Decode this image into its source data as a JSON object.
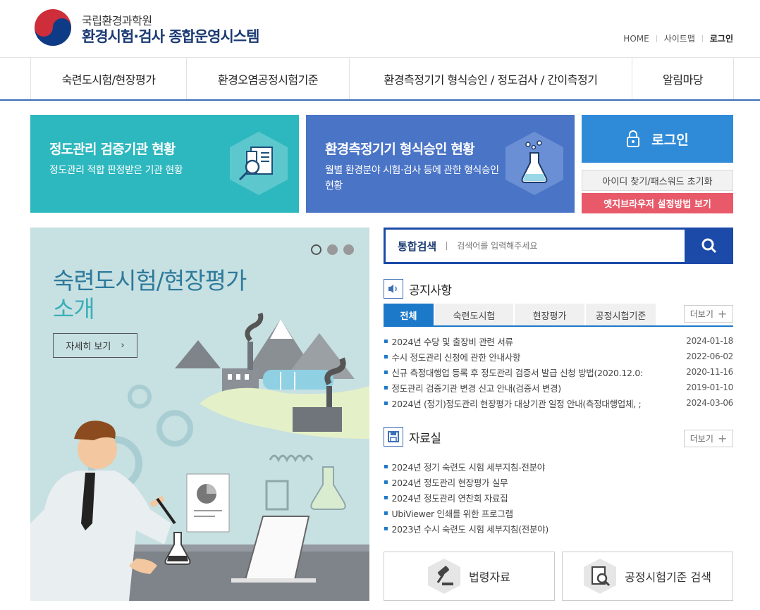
{
  "header": {
    "org_name": "국립환경과학원",
    "system_name": "환경시험·검사 종합운영시스템",
    "util": [
      "HOME",
      "사이트맵",
      "로그인"
    ]
  },
  "gnb": [
    "숙련도시험/현장평가",
    "환경오염공정시험기준",
    "환경측정기기 형식승인 / 정도검사 / 간이측정기",
    "알림마당"
  ],
  "banners": [
    {
      "title": "정도관리 검증기관 현황",
      "desc": "정도관리 적합 판정받은 기관 현황",
      "icon": "document-search-icon"
    },
    {
      "title": "환경측정기기 형식승인 현황",
      "desc": "월별 환경분야 시험·검사 등에 관한 형식승인 현황",
      "icon": "flask-icon"
    }
  ],
  "login": {
    "label": "로그인",
    "find": "아이디 찾기/패스워드 초기화",
    "edge": "엣지브라우저 설정방법 보기"
  },
  "visual": {
    "title": "숙련도시험/현장평가",
    "subtitle": "소개",
    "more": "자세히 보기"
  },
  "search": {
    "label": "통합검색",
    "placeholder": "검색어를 입력해주세요"
  },
  "notice": {
    "title": "공지사항",
    "tabs": [
      "전체",
      "숙련도시험",
      "현장평가",
      "공정시험기준"
    ],
    "more": "더보기",
    "items": [
      {
        "title": "2024년 수당 및 출장비 관련 서류",
        "date": "2024-01-18"
      },
      {
        "title": "수시 정도관리 신청에 관한 안내사항",
        "date": "2022-06-02"
      },
      {
        "title": "신규 측정대행업 등록 후 정도관리 검증서 발급 신청 방법(2020.12.0:",
        "date": "2020-11-16"
      },
      {
        "title": "정도관리 검증기관 변경 신고 안내(검증서 변경)",
        "date": "2019-01-10"
      },
      {
        "title": "2024년 (정기)정도관리 현장평가 대상기관 일정 안내(측정대행업체, ;",
        "date": "2024-03-06"
      }
    ]
  },
  "library": {
    "title": "자료실",
    "more": "더보기",
    "items": [
      {
        "title": "2024년 정기 숙련도 시험 세부지침-전분야"
      },
      {
        "title": "2024년 정도관리 현장평가 실무"
      },
      {
        "title": "2024년 정도관리 연찬회 자료집"
      },
      {
        "title": "UbiViewer 인쇄를 위한 프로그램"
      },
      {
        "title": "2023년 수시 숙련도 시험 세부지침(전분야)"
      }
    ]
  },
  "quick": [
    "법령자료",
    "공정시험기준 검색"
  ],
  "colors": {
    "primary": "#1b4aa8",
    "teal": "#2db7be",
    "blue": "#4a74c6",
    "accent": "#1c79c9",
    "edge": "#e85a6a"
  }
}
